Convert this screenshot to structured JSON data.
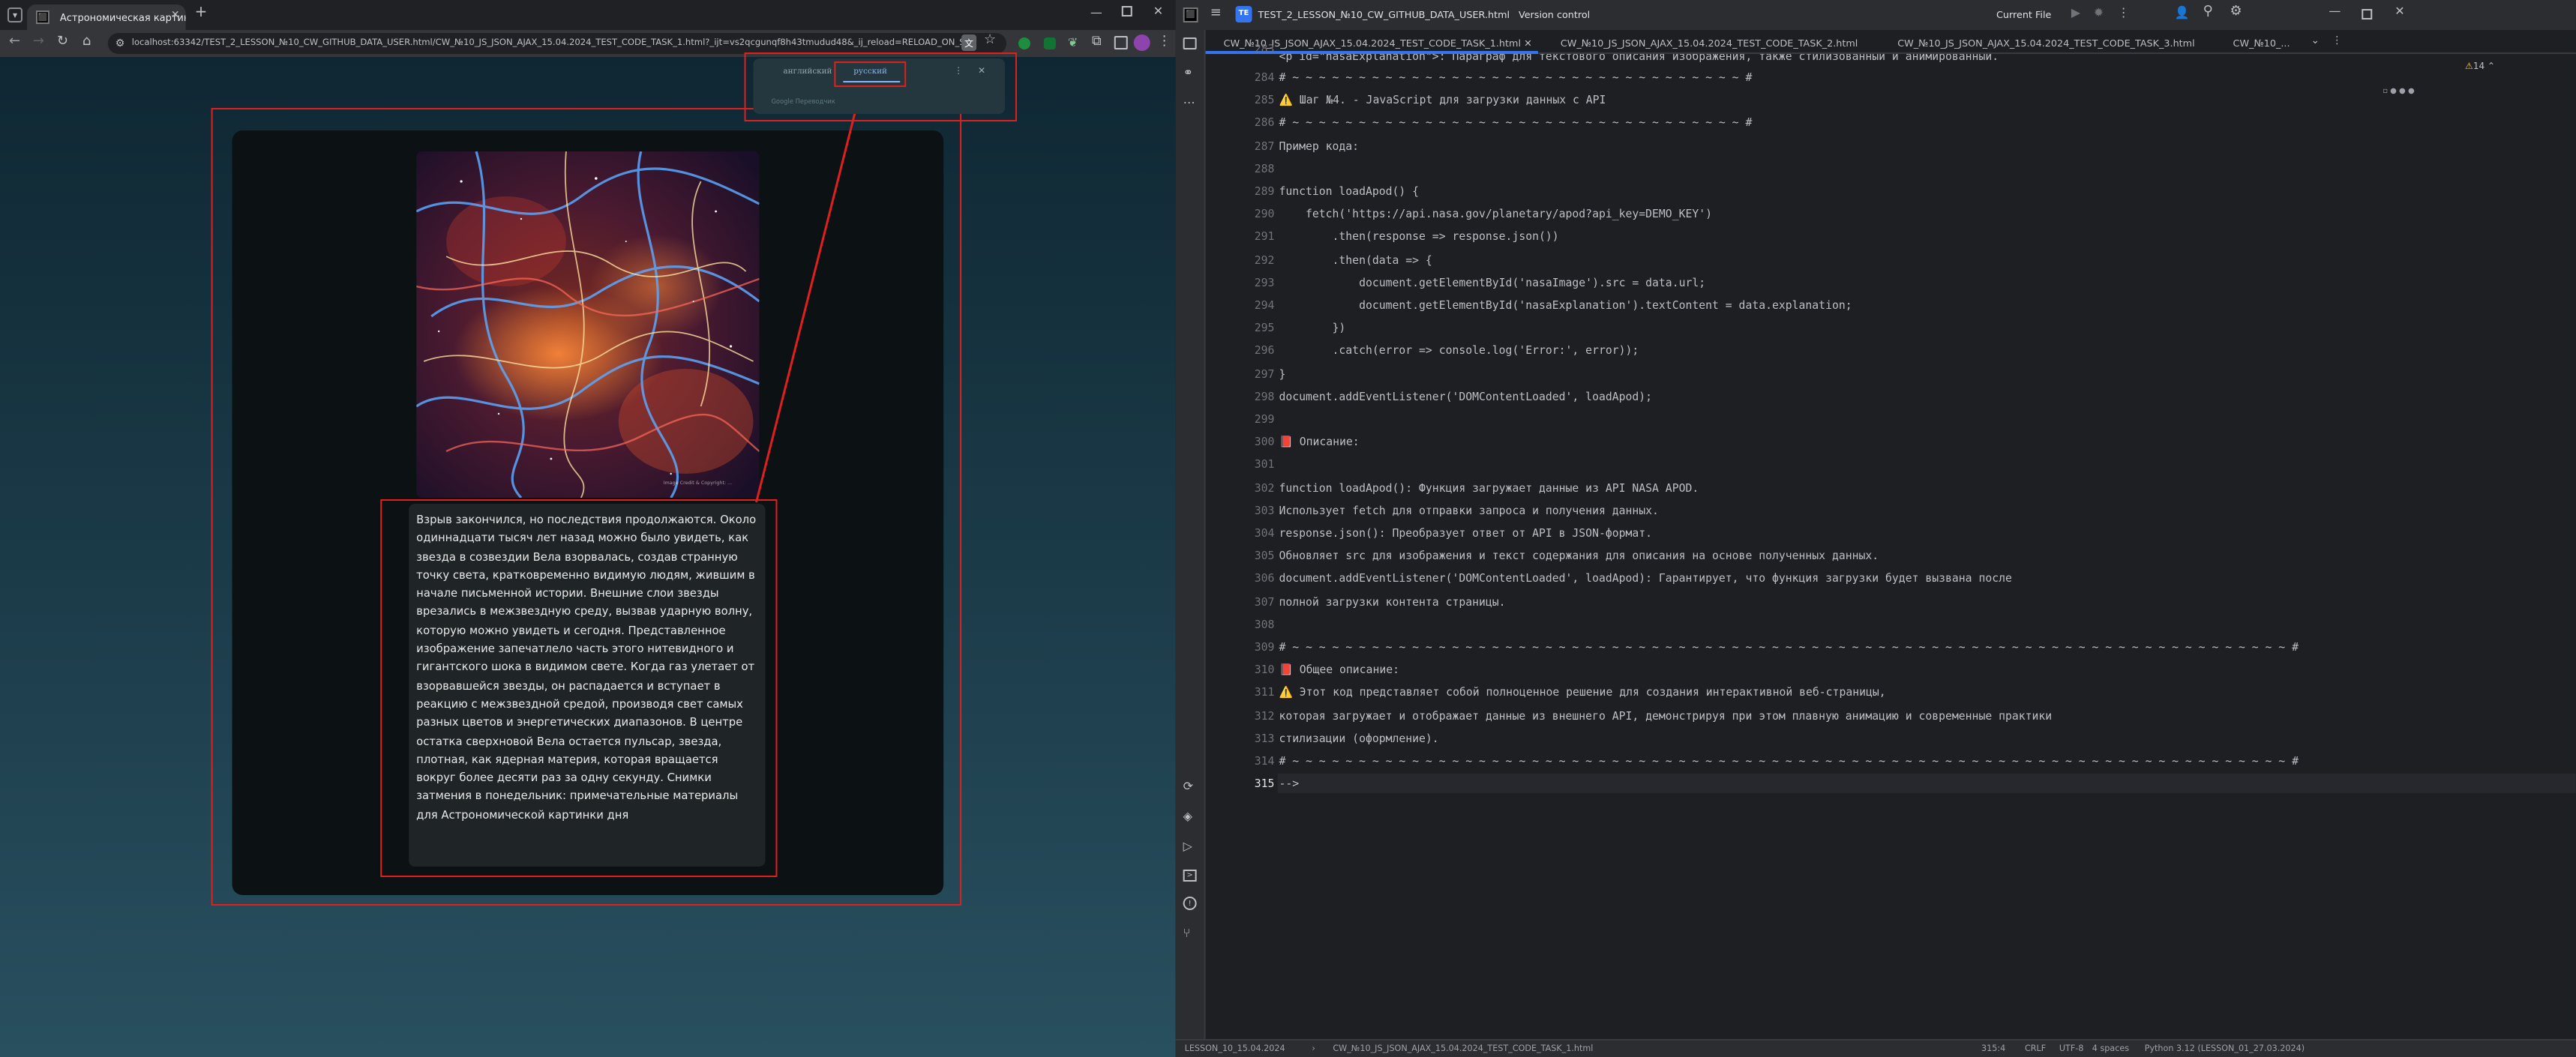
{
  "browser": {
    "tab_title": "Астрономическая картинка д",
    "new_tab": "+",
    "url": "localhost:63342/TEST_2_LESSON_№10_CW_GITHUB_DATA_USER.html/CW_№10_JS_JSON_AJAX_15.04.2024_TEST_CODE_TASK_1.html?_ijt=vs2qcgunqf8h43tmudud48&_ij_reload=RELOAD_ON_S...",
    "translate_popup": {
      "lang_from": "английский",
      "lang_to": "русский",
      "footer": "Google Переводчик"
    },
    "apod_text": "Взрыв закончился, но последствия продолжаются. Около одиннадцати тысяч лет назад можно было увидеть, как звезда в созвездии Вела взорвалась, создав странную точку света, кратковременно видимую людям, жившим в начале письменной истории. Внешние слои звезды врезались в межзвездную среду, вызвав ударную волну, которую можно увидеть и сегодня. Представленное изображение запечатлело часть этого нитевидного и гигантского шока в видимом свете. Когда газ улетает от взорвавшейся звезды, он распадается и вступает в реакцию с межзвездной средой, производя свет самых разных цветов и энергетических диапазонов. В центре остатка сверхновой Вела остается пульсар, звезда, плотная, как ядерная материя, которая вращается вокруг более десяти раз за одну секунду. Снимки затмения в понедельник: примечательные материалы для Астрономической картинки дня",
    "image_credit": "Image Credit & Copyright: ...",
    "annotation_color": "#e0201f"
  },
  "ide": {
    "project": "TEST_2_LESSON_№10_CW_GITHUB_DATA_USER.html",
    "project_badge": "TE",
    "vcs": "Version control",
    "run_config": "Current File",
    "tabs": [
      "CW_№10_JS_JSON_AJAX_15.04.2024_TEST_CODE_TASK_1.html",
      "CW_№10_JS_JSON_AJAX_15.04.2024_TEST_CODE_TASK_2.html",
      "CW_№10_JS_JSON_AJAX_15.04.2024_TEST_CODE_TASK_3.html",
      "CW_№10_..."
    ],
    "inspections": "14",
    "first_line": "<p id=\"nasaExplanation\">: Параграф для текстового описания изображения, также стилизованный и анимированный.",
    "lines": [
      {
        "n": "284",
        "t": "# ~ ~ ~ ~ ~ ~ ~ ~ ~ ~ ~ ~ ~ ~ ~ ~ ~ ~ ~ ~ ~ ~ ~ ~ ~ ~ ~ ~ ~ ~ ~ ~ ~ ~ #"
      },
      {
        "n": "285",
        "t": "⚠️ Шаг №4. - JavaScript для загрузки данных с API"
      },
      {
        "n": "286",
        "t": "# ~ ~ ~ ~ ~ ~ ~ ~ ~ ~ ~ ~ ~ ~ ~ ~ ~ ~ ~ ~ ~ ~ ~ ~ ~ ~ ~ ~ ~ ~ ~ ~ ~ ~ #"
      },
      {
        "n": "287",
        "t": "Пример кода:"
      },
      {
        "n": "288",
        "t": ""
      },
      {
        "n": "289",
        "t": "function loadApod() {"
      },
      {
        "n": "290",
        "t": "    fetch('https://api.nasa.gov/planetary/apod?api_key=DEMO_KEY')"
      },
      {
        "n": "291",
        "t": "        .then(response => response.json())"
      },
      {
        "n": "292",
        "t": "        .then(data => {"
      },
      {
        "n": "293",
        "t": "            document.getElementById('nasaImage').src = data.url;"
      },
      {
        "n": "294",
        "t": "            document.getElementById('nasaExplanation').textContent = data.explanation;"
      },
      {
        "n": "295",
        "t": "        })"
      },
      {
        "n": "296",
        "t": "        .catch(error => console.log('Error:', error));"
      },
      {
        "n": "297",
        "t": "}"
      },
      {
        "n": "298",
        "t": "document.addEventListener('DOMContentLoaded', loadApod);"
      },
      {
        "n": "299",
        "t": ""
      },
      {
        "n": "300",
        "t": "📕 Описание:"
      },
      {
        "n": "301",
        "t": ""
      },
      {
        "n": "302",
        "t": "function loadApod(): Функция загружает данные из API NASA APOD."
      },
      {
        "n": "303",
        "t": "Использует fetch для отправки запроса и получения данных."
      },
      {
        "n": "304",
        "t": "response.json(): Преобразует ответ от API в JSON-формат."
      },
      {
        "n": "305",
        "t": "Обновляет src для изображения и текст содержания для описания на основе полученных данных."
      },
      {
        "n": "306",
        "t": "document.addEventListener('DOMContentLoaded', loadApod): Гарантирует, что функция загрузки будет вызвана после"
      },
      {
        "n": "307",
        "t": "полной загрузки контента страницы."
      },
      {
        "n": "308",
        "t": ""
      },
      {
        "n": "309",
        "t": "# ~ ~ ~ ~ ~ ~ ~ ~ ~ ~ ~ ~ ~ ~ ~ ~ ~ ~ ~ ~ ~ ~ ~ ~ ~ ~ ~ ~ ~ ~ ~ ~ ~ ~ ~ ~ ~ ~ ~ ~ ~ ~ ~ ~ ~ ~ ~ ~ ~ ~ ~ ~ ~ ~ ~ ~ ~ ~ ~ ~ ~ ~ ~ ~ ~ ~ ~ ~ ~ ~ ~ ~ ~ ~ ~ #"
      },
      {
        "n": "310",
        "t": "📕 Общее описание:"
      },
      {
        "n": "311",
        "t": "⚠️ Этот код представляет собой полноценное решение для создания интерактивной веб-страницы,"
      },
      {
        "n": "312",
        "t": "которая загружает и отображает данные из внешнего API, демонстрируя при этом плавную анимацию и современные практики"
      },
      {
        "n": "313",
        "t": "стилизации (оформление)."
      },
      {
        "n": "314",
        "t": "# ~ ~ ~ ~ ~ ~ ~ ~ ~ ~ ~ ~ ~ ~ ~ ~ ~ ~ ~ ~ ~ ~ ~ ~ ~ ~ ~ ~ ~ ~ ~ ~ ~ ~ ~ ~ ~ ~ ~ ~ ~ ~ ~ ~ ~ ~ ~ ~ ~ ~ ~ ~ ~ ~ ~ ~ ~ ~ ~ ~ ~ ~ ~ ~ ~ ~ ~ ~ ~ ~ ~ ~ ~ ~ ~ #"
      },
      {
        "n": "315",
        "t": "-->"
      }
    ],
    "status": {
      "breadcrumb_root": "LESSON_10_15.04.2024",
      "breadcrumb_file": "CW_№10_JS_JSON_AJAX_15.04.2024_TEST_CODE_TASK_1.html",
      "position": "315:4",
      "line_sep": "CRLF",
      "encoding": "UTF-8",
      "indent": "4 spaces",
      "interpreter": "Python 3.12 (LESSON_01_27.03.2024)"
    }
  }
}
